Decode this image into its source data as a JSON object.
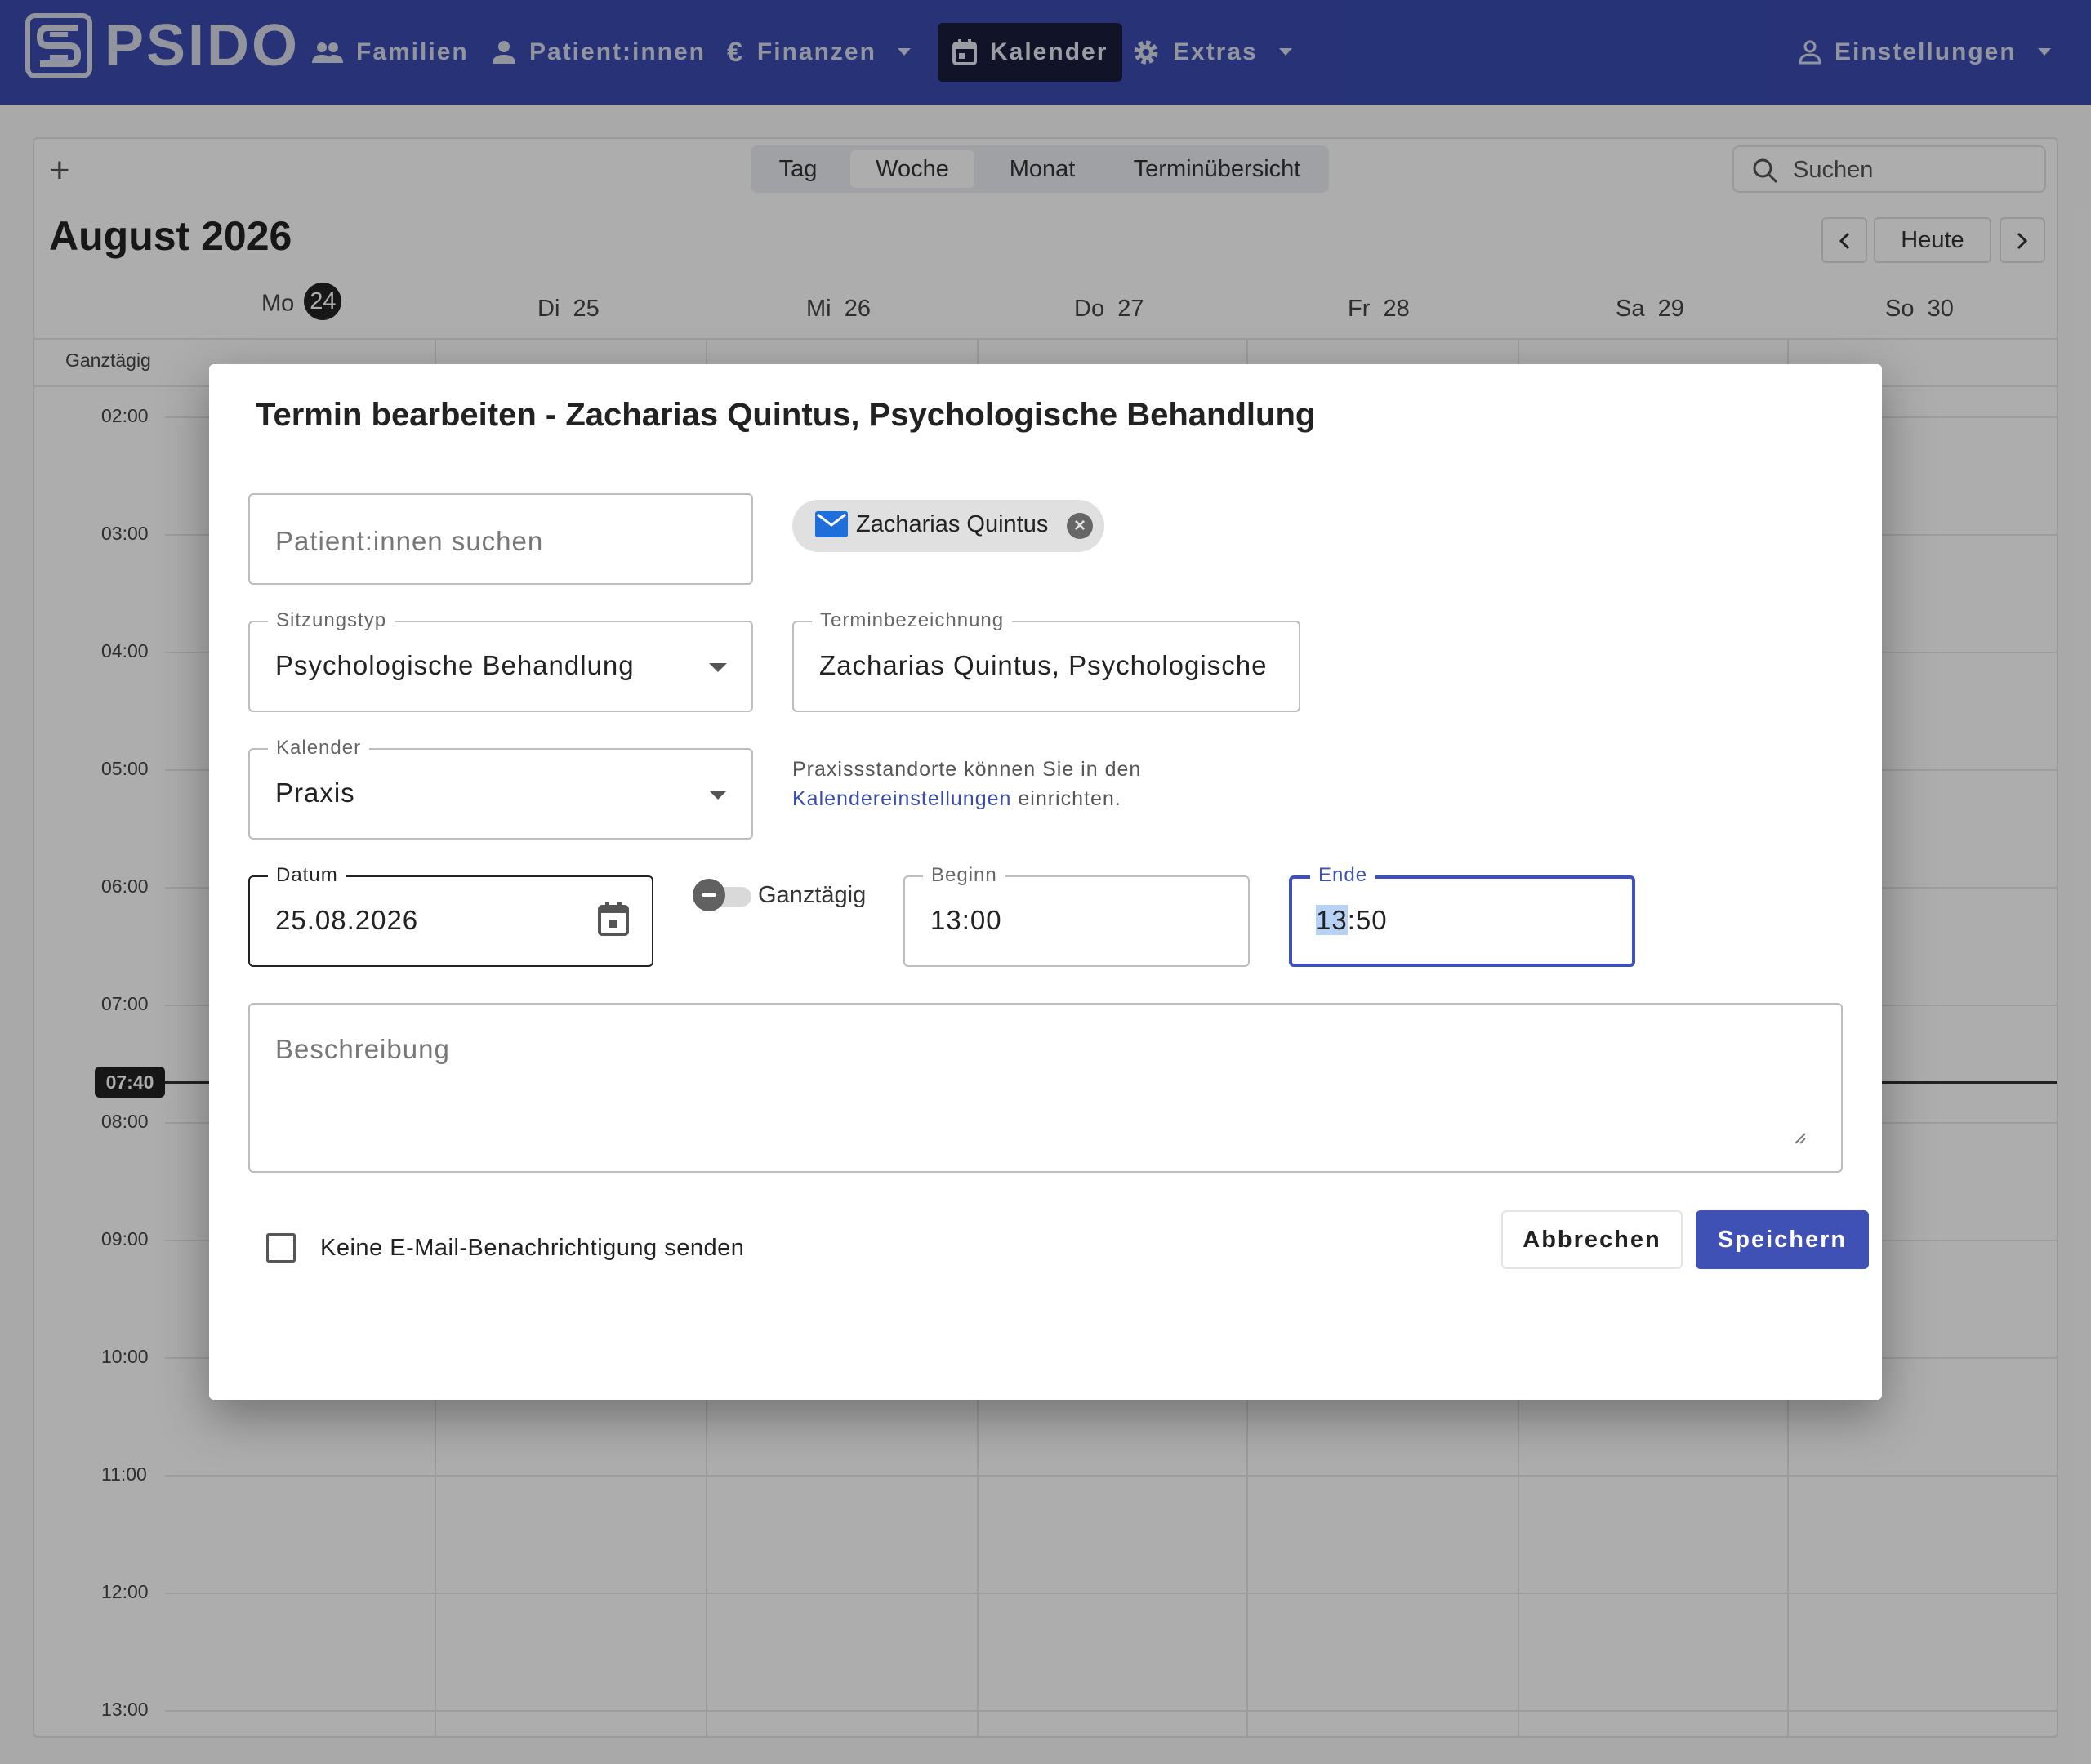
{
  "navbar": {
    "brand": "PSIDO",
    "items": [
      {
        "label": "Familien"
      },
      {
        "label": "Patient:innen"
      },
      {
        "label": "Finanzen"
      },
      {
        "label": "Kalender"
      },
      {
        "label": "Extras"
      },
      {
        "label": "Einstellungen"
      }
    ],
    "active": "Kalender",
    "colors": {
      "background": "#3a4bb0",
      "active_background": "#1a1d3b"
    }
  },
  "calendar": {
    "view_tabs": [
      "Tag",
      "Woche",
      "Monat",
      "Terminübersicht"
    ],
    "selected_view": "Woche",
    "search_placeholder": "Suchen",
    "month_title": "August 2026",
    "today_button": "Heute",
    "days": [
      {
        "name": "Mo",
        "num": "24",
        "today": true
      },
      {
        "name": "Di",
        "num": "25"
      },
      {
        "name": "Mi",
        "num": "26"
      },
      {
        "name": "Do",
        "num": "27"
      },
      {
        "name": "Fr",
        "num": "28"
      },
      {
        "name": "Sa",
        "num": "29"
      },
      {
        "name": "So",
        "num": "30"
      }
    ],
    "allday_label": "Ganztägig",
    "hours": [
      "02:00",
      "03:00",
      "04:00",
      "05:00",
      "06:00",
      "07:00",
      "08:00",
      "09:00",
      "10:00",
      "11:00",
      "12:00",
      "13:00"
    ],
    "current_time": "07:40"
  },
  "dialog": {
    "title": "Termin bearbeiten - Zacharias Quintus, Psychologische Behandlung",
    "patient_search_placeholder": "Patient:innen suchen",
    "patient_chip": "Zacharias Quintus",
    "session_type": {
      "label": "Sitzungstyp",
      "value": "Psychologische Behandlung"
    },
    "appointment_name": {
      "label": "Terminbezeichnung",
      "value": "Zacharias Quintus, Psychologische B"
    },
    "calendar": {
      "label": "Kalender",
      "value": "Praxis"
    },
    "helper": {
      "before": "Praxissstandorte können Sie in den",
      "link": "Kalendereinstellungen",
      "after": " einrichten."
    },
    "date": {
      "label": "Datum",
      "value": "25.08.2026"
    },
    "allday": {
      "label": "Ganztägig",
      "checked": false
    },
    "start": {
      "label": "Beginn",
      "value": "13:00"
    },
    "end": {
      "label": "Ende",
      "hour": "13",
      "rest": ":50"
    },
    "description_placeholder": "Beschreibung",
    "no_email": {
      "label": "Keine E-Mail-Benachrichtigung senden",
      "checked": false
    },
    "cancel": "Abbrechen",
    "save": "Speichern",
    "colors": {
      "primary": "#3f51b5"
    }
  }
}
